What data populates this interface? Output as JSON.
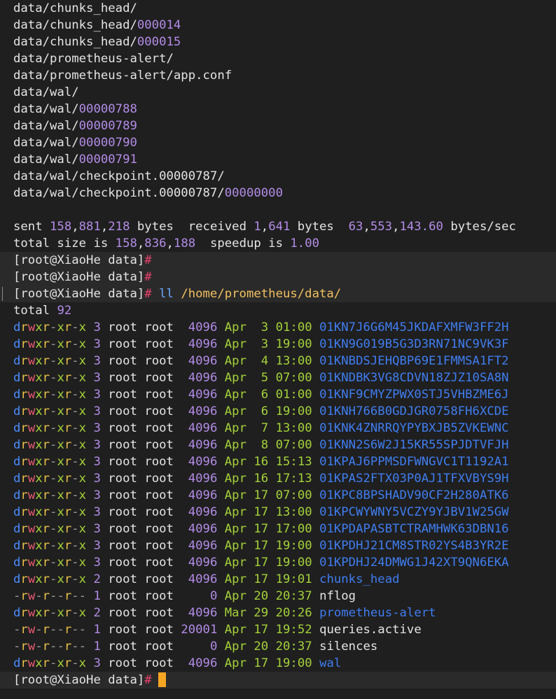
{
  "rsync": {
    "file_lines": [
      {
        "base": "data/chunks_head/",
        "num": ""
      },
      {
        "base": "data/chunks_head/",
        "num": "000014"
      },
      {
        "base": "data/chunks_head/",
        "num": "000015"
      },
      {
        "base": "data/prometheus-alert/",
        "num": ""
      },
      {
        "base": "data/prometheus-alert/app.conf",
        "num": ""
      },
      {
        "base": "data/wal/",
        "num": ""
      },
      {
        "base": "data/wal/",
        "num": "00000788"
      },
      {
        "base": "data/wal/",
        "num": "00000789"
      },
      {
        "base": "data/wal/",
        "num": "00000790"
      },
      {
        "base": "data/wal/",
        "num": "00000791"
      },
      {
        "base": "data/wal/checkpoint.00000787/",
        "num": ""
      },
      {
        "base": "data/wal/checkpoint.00000787/",
        "num": "00000000"
      }
    ],
    "sent_label": "sent ",
    "sent_a": "158",
    "sent_b": "881",
    "sent_c": "218",
    "sent_bytes": " bytes  received ",
    "recv_a": "1",
    "recv_b": "641",
    "recv_bytes": " bytes  ",
    "rate_a": "63",
    "rate_b": "553",
    "rate_c": "143.60",
    "rate_unit": " bytes/sec",
    "total_label": "total size is ",
    "total_a": "158",
    "total_b": "836",
    "total_c": "188",
    "speedup_label": "  speedup is ",
    "speedup_value": "1.00"
  },
  "prompt": {
    "text": "[root@XiaoHe data]",
    "hash": "#"
  },
  "command": {
    "cmd": "ll",
    "path": "/home/prometheus/data/"
  },
  "listing": {
    "total_label": "total ",
    "total_value": "92",
    "rows": [
      {
        "perm": "drwxr-xr-x",
        "links": "3",
        "owner": "root",
        "group": "root",
        "size": " 4096",
        "month": "Apr",
        "day": " 3",
        "time": "01:00",
        "name": "01KN7J6G6M45JKDAFXMFW3FF2H",
        "dir": true
      },
      {
        "perm": "drwxr-xr-x",
        "links": "3",
        "owner": "root",
        "group": "root",
        "size": " 4096",
        "month": "Apr",
        "day": " 3",
        "time": "19:00",
        "name": "01KN9G019B5G3D3RN71NC9VK3F",
        "dir": true
      },
      {
        "perm": "drwxr-xr-x",
        "links": "3",
        "owner": "root",
        "group": "root",
        "size": " 4096",
        "month": "Apr",
        "day": " 4",
        "time": "13:00",
        "name": "01KNBDSJEHQBP69E1FMMSA1FT2",
        "dir": true
      },
      {
        "perm": "drwxr-xr-x",
        "links": "3",
        "owner": "root",
        "group": "root",
        "size": " 4096",
        "month": "Apr",
        "day": " 5",
        "time": "07:00",
        "name": "01KNDBK3VG8CDVN18ZJZ10SA8N",
        "dir": true
      },
      {
        "perm": "drwxr-xr-x",
        "links": "3",
        "owner": "root",
        "group": "root",
        "size": " 4096",
        "month": "Apr",
        "day": " 6",
        "time": "01:00",
        "name": "01KNF9CMYZPWX0STJ5VHBZME6J",
        "dir": true
      },
      {
        "perm": "drwxr-xr-x",
        "links": "3",
        "owner": "root",
        "group": "root",
        "size": " 4096",
        "month": "Apr",
        "day": " 6",
        "time": "19:00",
        "name": "01KNH766B0GDJGR0758FH6XCDE",
        "dir": true
      },
      {
        "perm": "drwxr-xr-x",
        "links": "3",
        "owner": "root",
        "group": "root",
        "size": " 4096",
        "month": "Apr",
        "day": " 7",
        "time": "13:00",
        "name": "01KNK4ZNRRQYPYBXJB5ZVKEWNC",
        "dir": true
      },
      {
        "perm": "drwxr-xr-x",
        "links": "3",
        "owner": "root",
        "group": "root",
        "size": " 4096",
        "month": "Apr",
        "day": " 8",
        "time": "07:00",
        "name": "01KNN2S6W2J15KR55SPJDTVFJH",
        "dir": true
      },
      {
        "perm": "drwxr-xr-x",
        "links": "3",
        "owner": "root",
        "group": "root",
        "size": " 4096",
        "month": "Apr",
        "day": "16",
        "time": "15:13",
        "name": "01KPAJ6PPMSDFWNGVC1T1192A1",
        "dir": true
      },
      {
        "perm": "drwxr-xr-x",
        "links": "3",
        "owner": "root",
        "group": "root",
        "size": " 4096",
        "month": "Apr",
        "day": "16",
        "time": "17:13",
        "name": "01KPAS2FTX03P0AJ1TFXVBYS9H",
        "dir": true
      },
      {
        "perm": "drwxr-xr-x",
        "links": "3",
        "owner": "root",
        "group": "root",
        "size": " 4096",
        "month": "Apr",
        "day": "17",
        "time": "07:00",
        "name": "01KPC8BPSHADV90CF2H280ATK6",
        "dir": true
      },
      {
        "perm": "drwxr-xr-x",
        "links": "3",
        "owner": "root",
        "group": "root",
        "size": " 4096",
        "month": "Apr",
        "day": "17",
        "time": "13:00",
        "name": "01KPCWYWNY5VCZY9YJBV1W25GW",
        "dir": true
      },
      {
        "perm": "drwxr-xr-x",
        "links": "3",
        "owner": "root",
        "group": "root",
        "size": " 4096",
        "month": "Apr",
        "day": "17",
        "time": "17:00",
        "name": "01KPDAPASBTCTRAMHWK63DBN16",
        "dir": true
      },
      {
        "perm": "drwxr-xr-x",
        "links": "3",
        "owner": "root",
        "group": "root",
        "size": " 4096",
        "month": "Apr",
        "day": "17",
        "time": "19:00",
        "name": "01KPDHJ21CM8STR02YS4B3YR2E",
        "dir": true
      },
      {
        "perm": "drwxr-xr-x",
        "links": "3",
        "owner": "root",
        "group": "root",
        "size": " 4096",
        "month": "Apr",
        "day": "17",
        "time": "19:00",
        "name": "01KPDHJ24DMWG1J42XT9QN6EKA",
        "dir": true
      },
      {
        "perm": "drwxr-xr-x",
        "links": "2",
        "owner": "root",
        "group": "root",
        "size": " 4096",
        "month": "Apr",
        "day": "17",
        "time": "19:01",
        "name": "chunks_head",
        "dir": true
      },
      {
        "perm": "-rw-r--r--",
        "links": "1",
        "owner": "root",
        "group": "root",
        "size": "    0",
        "month": "Apr",
        "day": "20",
        "time": "20:37",
        "name": "nflog",
        "dir": false
      },
      {
        "perm": "drwxr-xr-x",
        "links": "2",
        "owner": "root",
        "group": "root",
        "size": " 4096",
        "month": "Mar",
        "day": "29",
        "time": "20:26",
        "name": "prometheus-alert",
        "dir": true
      },
      {
        "perm": "-rw-r--r--",
        "links": "1",
        "owner": "root",
        "group": "root",
        "size": "20001",
        "month": "Apr",
        "day": "17",
        "time": "19:52",
        "name": "queries.active",
        "dir": false
      },
      {
        "perm": "-rw-r--r--",
        "links": "1",
        "owner": "root",
        "group": "root",
        "size": "    0",
        "month": "Apr",
        "day": "20",
        "time": "20:37",
        "name": "silences",
        "dir": false
      },
      {
        "perm": "drwxr-xr-x",
        "links": "3",
        "owner": "root",
        "group": "root",
        "size": " 4096",
        "month": "Apr",
        "day": "17",
        "time": "19:00",
        "name": "wal",
        "dir": true
      }
    ]
  },
  "colors": {
    "background": "#1f1f1f",
    "text": "#e4e4e4",
    "number": "#b28ce6",
    "prompt_hash": "#e8416c",
    "directory": "#3f7df0",
    "date": "#a5d13a",
    "cursor": "#f5a623"
  }
}
